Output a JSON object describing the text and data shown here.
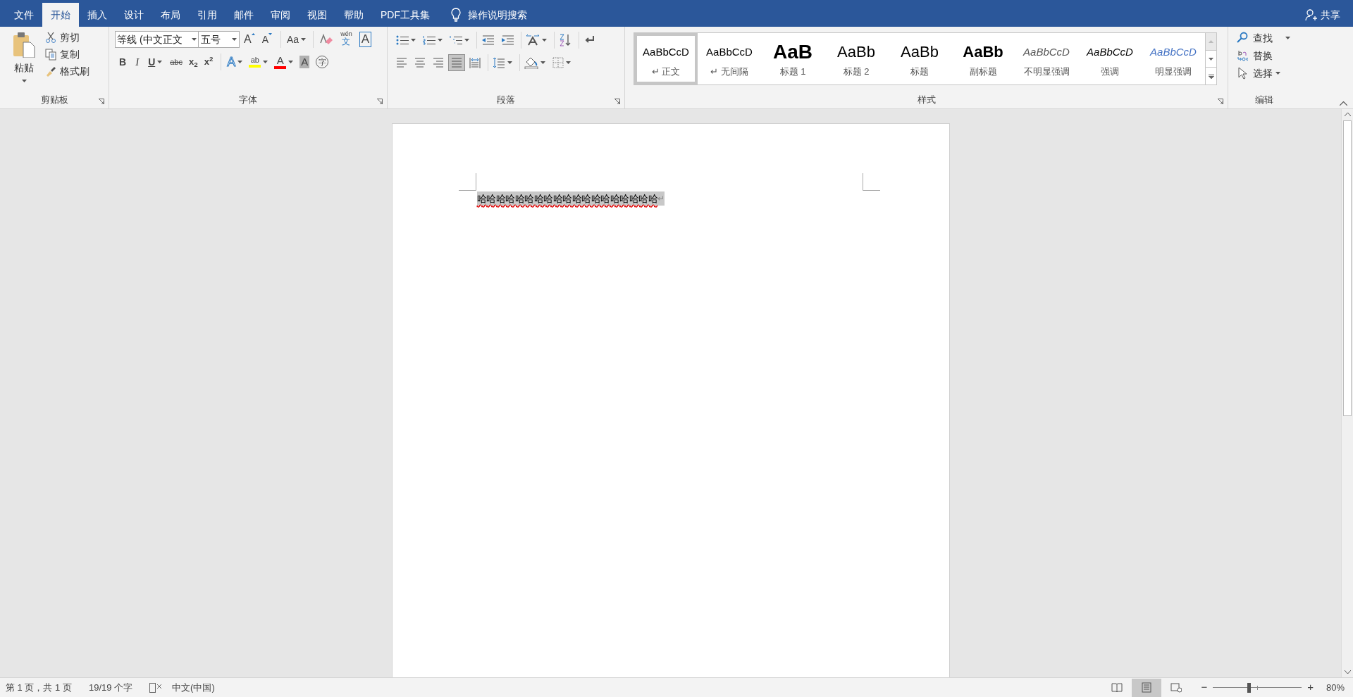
{
  "tabs": [
    {
      "label": "文件",
      "selected": false
    },
    {
      "label": "开始",
      "selected": true
    },
    {
      "label": "插入",
      "selected": false
    },
    {
      "label": "设计",
      "selected": false
    },
    {
      "label": "布局",
      "selected": false
    },
    {
      "label": "引用",
      "selected": false
    },
    {
      "label": "邮件",
      "selected": false
    },
    {
      "label": "审阅",
      "selected": false
    },
    {
      "label": "视图",
      "selected": false
    },
    {
      "label": "帮助",
      "selected": false
    },
    {
      "label": "PDF工具集",
      "selected": false
    }
  ],
  "tell_me": "操作说明搜索",
  "share": "共享",
  "clipboard": {
    "label": "剪贴板",
    "paste": "粘贴",
    "items": [
      {
        "kind": "cut",
        "label": "剪切"
      },
      {
        "kind": "copy",
        "label": "复制"
      },
      {
        "kind": "painter",
        "label": "格式刷"
      }
    ]
  },
  "font": {
    "label": "字体",
    "name": "等线 (中文正文",
    "size": "五号",
    "row1": [
      {
        "kind": "grow",
        "glyph": "A"
      },
      {
        "kind": "shrink",
        "glyph": "A"
      },
      {
        "kind": "case",
        "glyph": "Aa"
      },
      {
        "kind": "clear"
      },
      {
        "kind": "phonetic",
        "glyph": "wén",
        "glyph2": "文"
      },
      {
        "kind": "border",
        "glyph": "A"
      }
    ],
    "row2": [
      {
        "kind": "bold",
        "glyph": "B"
      },
      {
        "kind": "italic",
        "glyph": "I"
      },
      {
        "kind": "underline",
        "glyph": "U"
      },
      {
        "kind": "strike",
        "glyph": "abc"
      },
      {
        "kind": "sub",
        "glyph": "x$_{2}$"
      },
      {
        "kind": "sup",
        "glyph": "x$^{2}$"
      },
      {
        "kind": "effects",
        "glyph": "A"
      },
      {
        "kind": "highlight",
        "glyph": "ab",
        "color": "#ffff00"
      },
      {
        "kind": "color",
        "glyph": "A",
        "color": "#ff0000"
      },
      {
        "kind": "shade",
        "glyph": "A"
      },
      {
        "kind": "enclose",
        "glyph": "字"
      }
    ]
  },
  "paragraph": {
    "label": "段落",
    "alignment": [
      {
        "kind": "left",
        "selected": false
      },
      {
        "kind": "center",
        "selected": false
      },
      {
        "kind": "right",
        "selected": false
      },
      {
        "kind": "justify",
        "selected": true
      },
      {
        "kind": "distributed",
        "selected": false
      }
    ]
  },
  "styles": {
    "label": "样式",
    "items": [
      {
        "kind": "normal",
        "sample": "AaBbCcD",
        "name": "正文",
        "mark": "↵",
        "selected": true
      },
      {
        "kind": "normal",
        "sample": "AaBbCcD",
        "name": "无间隔",
        "mark": "↵",
        "selected": false
      },
      {
        "kind": "h1",
        "sample": "AaB",
        "name": "标题 1",
        "selected": false
      },
      {
        "kind": "h2",
        "sample": "AaBb",
        "name": "标题 2",
        "selected": false
      },
      {
        "kind": "title",
        "sample": "AaBb",
        "name": "标题",
        "selected": false
      },
      {
        "kind": "subtitle",
        "sample": "AaBb",
        "name": "副标题",
        "selected": false
      },
      {
        "kind": "subtle",
        "sample": "AaBbCcD",
        "name": "不明显强调",
        "selected": false
      },
      {
        "kind": "emphasis",
        "sample": "AaBbCcD",
        "name": "强调",
        "selected": false
      },
      {
        "kind": "intense",
        "sample": "AaBbCcD",
        "name": "明显强调",
        "selected": false
      }
    ]
  },
  "editing": {
    "label": "编辑",
    "items": [
      {
        "kind": "find",
        "label": "查找"
      },
      {
        "kind": "replace",
        "label": "替换"
      },
      {
        "kind": "select",
        "label": "选择"
      }
    ]
  },
  "document": {
    "text": "哈哈哈哈哈哈哈哈哈哈哈哈哈哈哈哈哈哈哈",
    "paragraph_mark": "↵",
    "selected": true,
    "spelling_error": true
  },
  "status_bar": {
    "page": "第 1 页，共 1 页",
    "words": "19/19 个字",
    "language": "中文(中国)",
    "views": [
      {
        "kind": "read",
        "selected": false
      },
      {
        "kind": "print",
        "selected": true
      },
      {
        "kind": "web",
        "selected": false
      }
    ],
    "zoom": {
      "level": 0.4,
      "minus": "−",
      "plus": "+",
      "reading": "80%"
    }
  }
}
